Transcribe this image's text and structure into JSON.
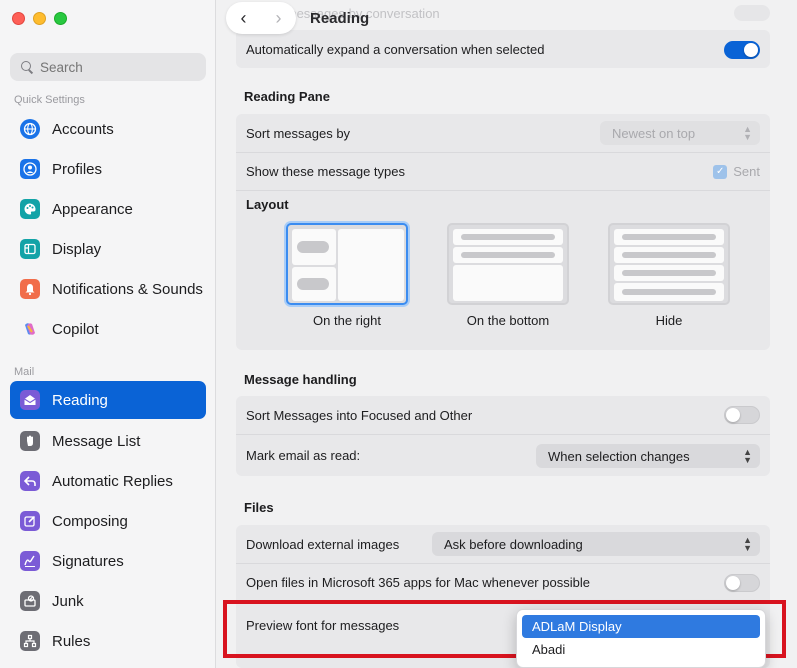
{
  "sidebar": {
    "search_placeholder": "Search",
    "sections": {
      "quick_settings": "Quick Settings",
      "mail": "Mail"
    },
    "items": [
      {
        "label": "Accounts",
        "icon": "globe-icon",
        "color": "#1a73e8"
      },
      {
        "label": "Profiles",
        "icon": "person-icon",
        "color": "#1a73e8"
      },
      {
        "label": "Appearance",
        "icon": "palette-icon",
        "color": "#13a3a7"
      },
      {
        "label": "Display",
        "icon": "display-icon",
        "color": "#13a3a7"
      },
      {
        "label": "Notifications & Sounds",
        "icon": "bell-icon",
        "color": "#f16d4a"
      },
      {
        "label": "Copilot",
        "icon": "copilot-icon",
        "color": "#9b6bdc"
      },
      {
        "label": "Reading",
        "icon": "envelope-open-icon",
        "color": "#7b5bd6"
      },
      {
        "label": "Message List",
        "icon": "hand-icon",
        "color": "#6d6d74"
      },
      {
        "label": "Automatic Replies",
        "icon": "reply-icon",
        "color": "#7b5bd6"
      },
      {
        "label": "Composing",
        "icon": "compose-icon",
        "color": "#7b5bd6"
      },
      {
        "label": "Signatures",
        "icon": "signature-icon",
        "color": "#7b5bd6"
      },
      {
        "label": "Junk",
        "icon": "junk-icon",
        "color": "#6d6d74"
      },
      {
        "label": "Rules",
        "icon": "rules-icon",
        "color": "#6d6d74"
      }
    ]
  },
  "header": {
    "title": "Reading",
    "back": "‹",
    "forward": "›"
  },
  "top": {
    "ghost_row": "Group messages by conversation",
    "auto_expand": "Automatically expand a conversation when selected",
    "auto_expand_on": true
  },
  "reading_pane": {
    "title": "Reading Pane",
    "sort_label": "Sort messages by",
    "sort_value": "Newest on top",
    "types_label": "Show these message types",
    "types_value": "Sent",
    "layout_title": "Layout",
    "layout_options": [
      "On the right",
      "On the bottom",
      "Hide"
    ],
    "layout_selected": "On the right"
  },
  "message_handling": {
    "title": "Message handling",
    "focused_label": "Sort Messages into Focused and Other",
    "focused_on": false,
    "mark_read_label": "Mark email as read:",
    "mark_read_value": "When selection changes"
  },
  "files": {
    "title": "Files",
    "download_label": "Download external images",
    "download_value": "Ask before downloading",
    "open_files_label": "Open files in Microsoft 365 apps for Mac whenever possible",
    "open_files_on": false,
    "preview_font_label": "Preview font for messages"
  },
  "font_dropdown": {
    "options": [
      "ADLaM Display",
      "Abadi"
    ],
    "selected": "ADLaM Display"
  },
  "colors": {
    "accent": "#0a63d6",
    "highlight": "#d8131f"
  }
}
